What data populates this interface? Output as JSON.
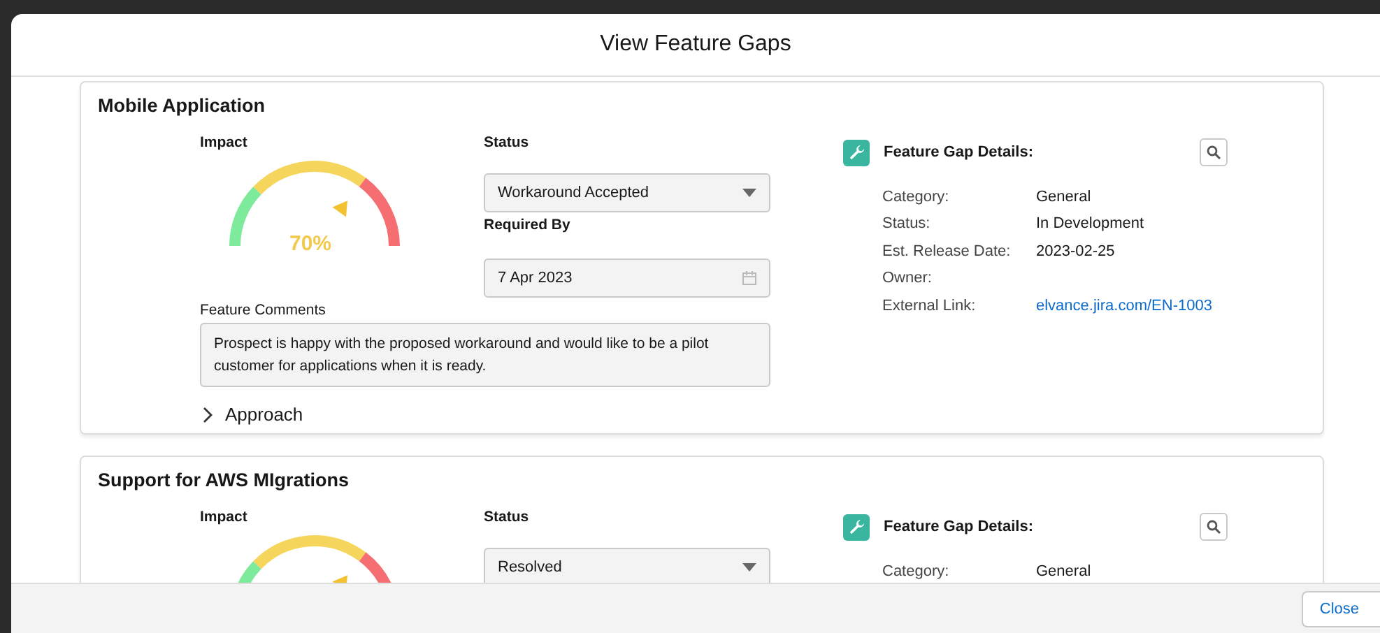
{
  "window": {
    "title": "View Feature Gaps"
  },
  "cards": [
    {
      "title": "Mobile Application",
      "impact_label": "Impact",
      "gauge": {
        "reading": "70%"
      },
      "status_label": "Status",
      "status": "Workaround Accepted",
      "required_by_label": "Required By",
      "required_by": "7 Apr 2023",
      "comments_label": "Feature Comments",
      "comments": "Prospect is happy with the proposed workaround and would like to be a pilot customer for applications when it is ready.",
      "approach": {
        "label": "Approach",
        "expanded": false
      },
      "details": {
        "title": "Feature Gap Details:",
        "rows": [
          {
            "label": "Category:",
            "value": "General",
            "kind": "text"
          },
          {
            "label": "Status:",
            "value": "In Development",
            "kind": "text"
          },
          {
            "label": "Est. Release Date:",
            "value": "2023-02-25",
            "kind": "text"
          },
          {
            "label": "Owner:",
            "kind": "text"
          },
          {
            "label": "External Link:",
            "value": "elvance.jira.com/EN-1003",
            "kind": "link"
          }
        ]
      }
    },
    {
      "title": "Support for AWS MIgrations",
      "impact_label": "Impact",
      "status_label": "Status",
      "status": "Resolved",
      "details": {
        "title": "Feature Gap Details:",
        "rows": [
          {
            "label": "Category:",
            "value": "General",
            "kind": "text"
          }
        ]
      }
    }
  ],
  "footer": {
    "close": "Close"
  }
}
